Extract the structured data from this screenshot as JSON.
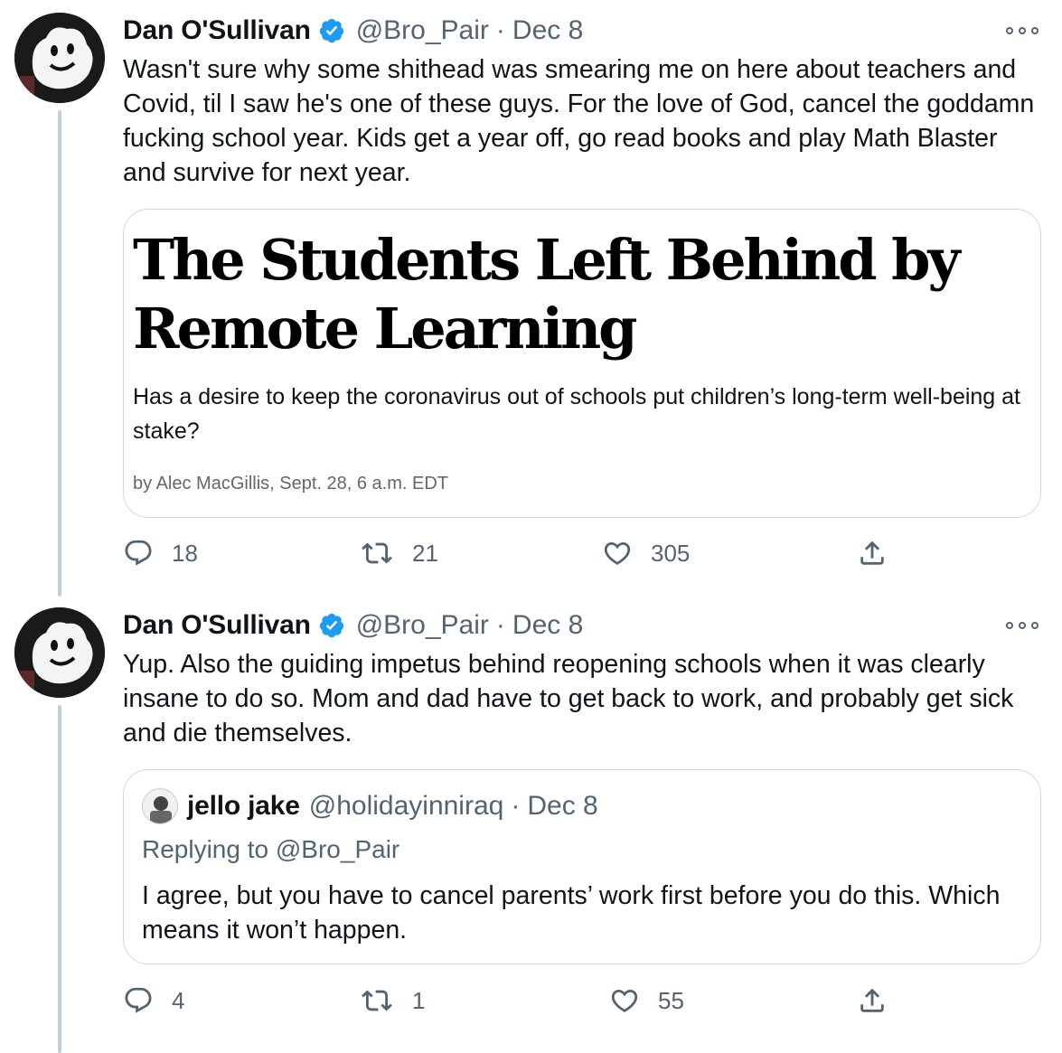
{
  "tweet1": {
    "author_name": "Dan O'Sullivan",
    "handle": "@Bro_Pair",
    "separator": "·",
    "date": "Dec 8",
    "text": "Wasn't sure why some shithead was smearing me on here about teachers and Covid, til I saw he's one of these guys. For the love of God, cancel the goddamn fucking school year. Kids get a year off, go read books and play Math Blaster and survive for next year.",
    "card": {
      "headline": "The Students Left Behind by Remote Learning",
      "dek": "Has a desire to keep the coronavirus out of schools put children’s long-term well-being at stake?",
      "byline": "by Alec MacGillis, Sept. 28, 6 a.m. EDT"
    },
    "replies": "18",
    "retweets": "21",
    "likes": "305"
  },
  "tweet2": {
    "author_name": "Dan O'Sullivan",
    "handle": "@Bro_Pair",
    "separator": "·",
    "date": "Dec 8",
    "text": "Yup. Also the guiding impetus behind reopening schools when it was clearly insane to do so. Mom and dad have to get back to work, and probably get sick and die themselves.",
    "quote": {
      "author_name": "jello jake",
      "handle": "@holidayinniraq",
      "separator": "·",
      "date": "Dec 8",
      "replying_prefix": "Replying to",
      "replying_handle": "@Bro_Pair",
      "text": "I agree, but you have to cancel parents’ work first before you do this. Which means it won’t happen."
    },
    "replies": "4",
    "retweets": "1",
    "likes": "55"
  },
  "colors": {
    "verified": "#1d9bf0",
    "muted": "#536471",
    "border": "#cfd9de",
    "thread_line": "#c4cfd6"
  },
  "icons": [
    "verified-badge-icon",
    "more-icon",
    "reply-icon",
    "retweet-icon",
    "like-icon",
    "share-icon"
  ]
}
